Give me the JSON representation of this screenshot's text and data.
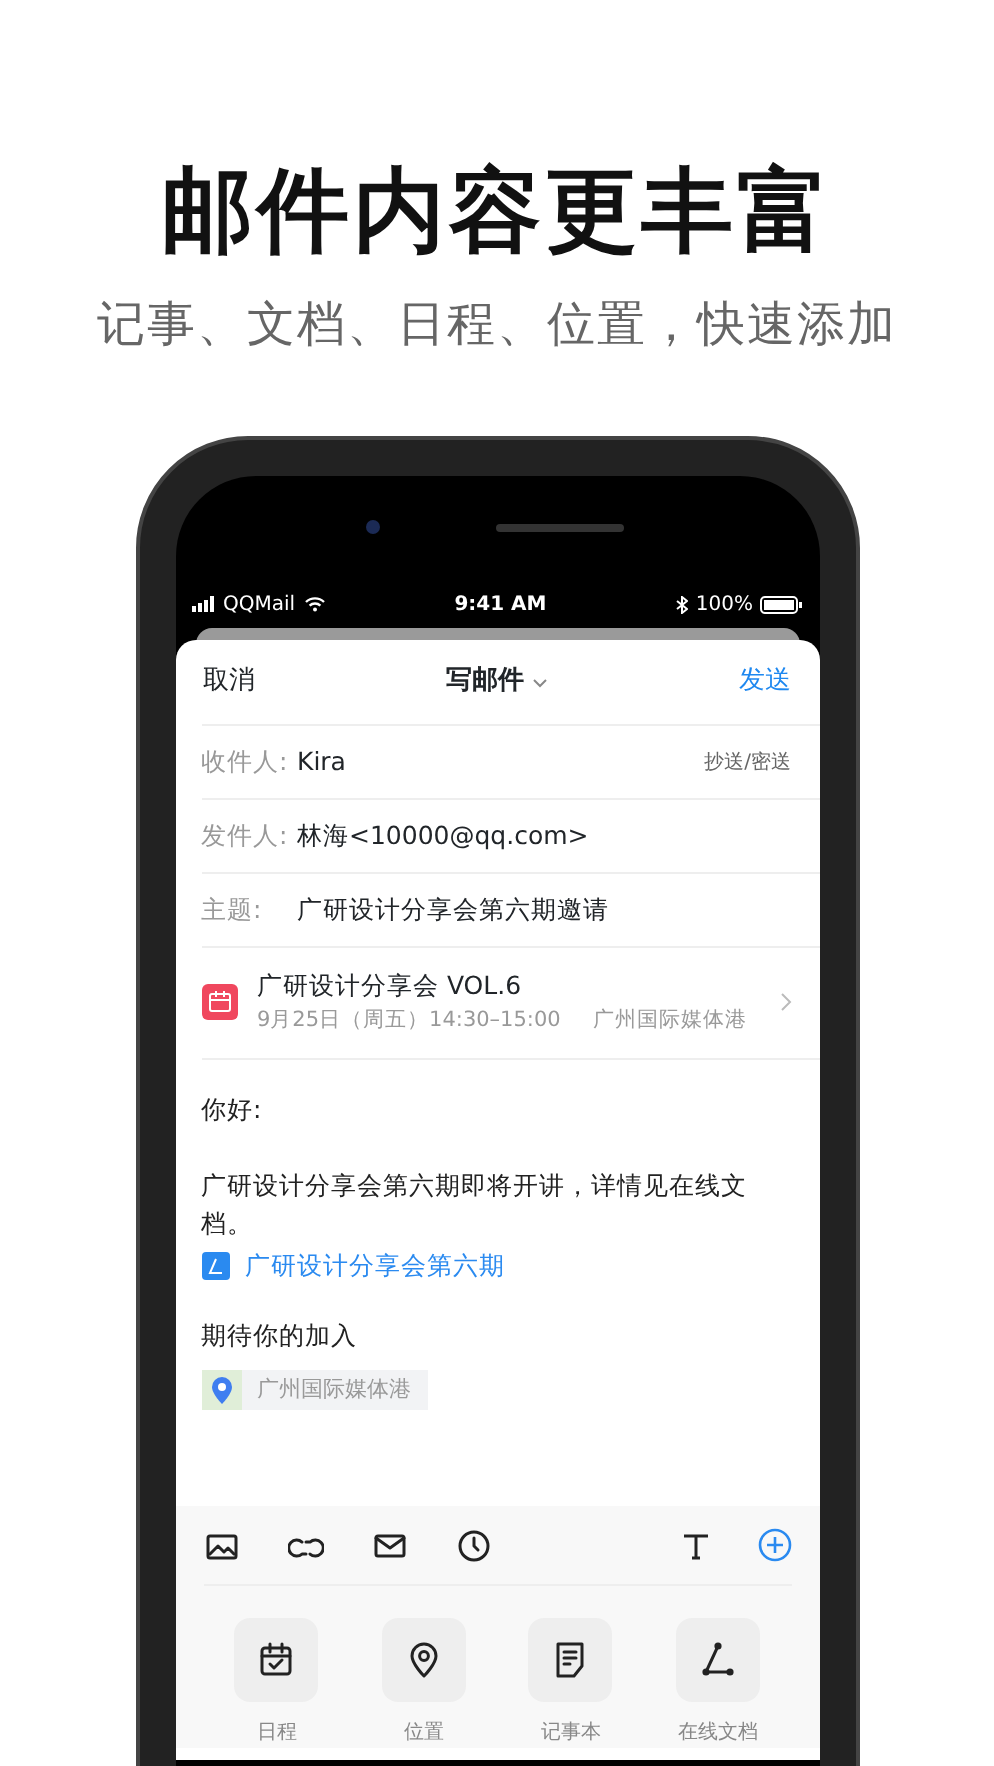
{
  "headline": "邮件内容更丰富",
  "subtitle": "记事、文档、日程、位置，快速添加",
  "status_bar": {
    "carrier": "QQMail",
    "time": "9:41 AM",
    "battery": "100%"
  },
  "compose": {
    "cancel": "取消",
    "title": "写邮件",
    "send": "发送",
    "fields": [
      {
        "label": "收件人:",
        "value": "Kira",
        "action": "抄送/密送"
      },
      {
        "label": "发件人:",
        "value": "林海<10000@qq.com>"
      },
      {
        "label": "主题:",
        "value": "广研设计分享会第六期邀请"
      }
    ],
    "event": {
      "title": "广研设计分享会 VOL.6",
      "time": "9月25日（周五）14:30–15:00",
      "location": "广州国际媒体港"
    },
    "body": {
      "greeting": "你好:",
      "paragraph": "广研设计分享会第六期即将开讲，详情见在线文档。",
      "doc_link": "广研设计分享会第六期",
      "closing": "期待你的加入",
      "location_chip": "广州国际媒体港"
    }
  },
  "attachments": [
    {
      "label": "日程"
    },
    {
      "label": "位置"
    },
    {
      "label": "记事本"
    },
    {
      "label": "在线文档"
    }
  ]
}
